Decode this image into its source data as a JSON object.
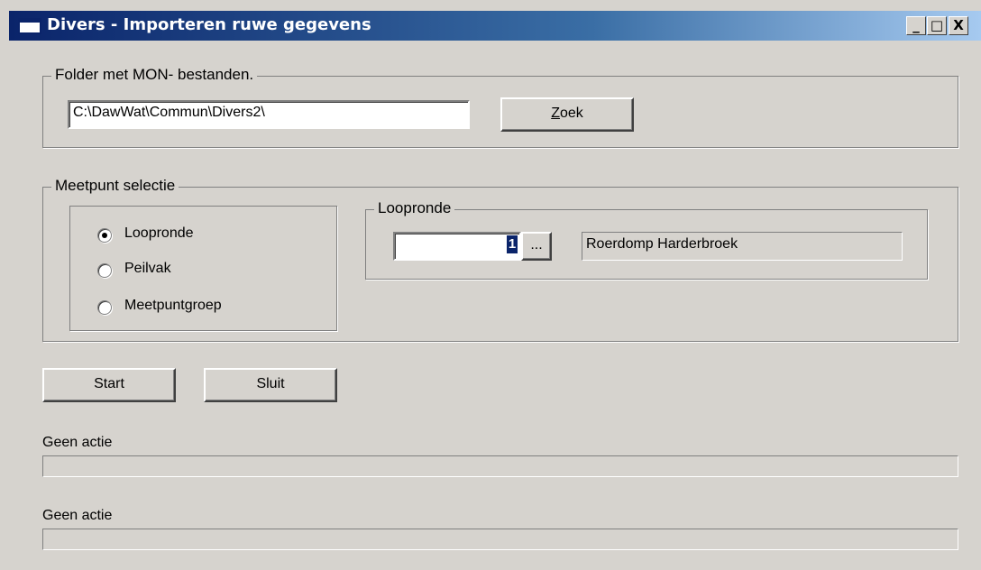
{
  "window": {
    "title": "Divers - Importeren ruwe gegevens",
    "controls": {
      "minimize": "_",
      "maximize": "□",
      "close": "X"
    }
  },
  "folder_group": {
    "legend": "Folder met MON- bestanden.",
    "path_value": "C:\\DawWat\\Commun\\Divers2\\",
    "search_button": {
      "mnemonic": "Z",
      "rest": "oek"
    }
  },
  "meetpunt_group": {
    "legend": "Meetpunt selectie",
    "options": [
      {
        "label": "Loopronde",
        "selected": true
      },
      {
        "label": "Peilvak",
        "selected": false
      },
      {
        "label": "Meetpuntgroep",
        "selected": false
      }
    ],
    "loopronde_group": {
      "legend": "Loopronde",
      "number_value": "1",
      "browse_button": "...",
      "name_value": "Roerdomp Harderbroek"
    }
  },
  "actions": {
    "start": "Start",
    "close": "Sluit"
  },
  "status": [
    {
      "label": "Geen actie",
      "progress": 0
    },
    {
      "label": "Geen actie",
      "progress": 0
    }
  ]
}
